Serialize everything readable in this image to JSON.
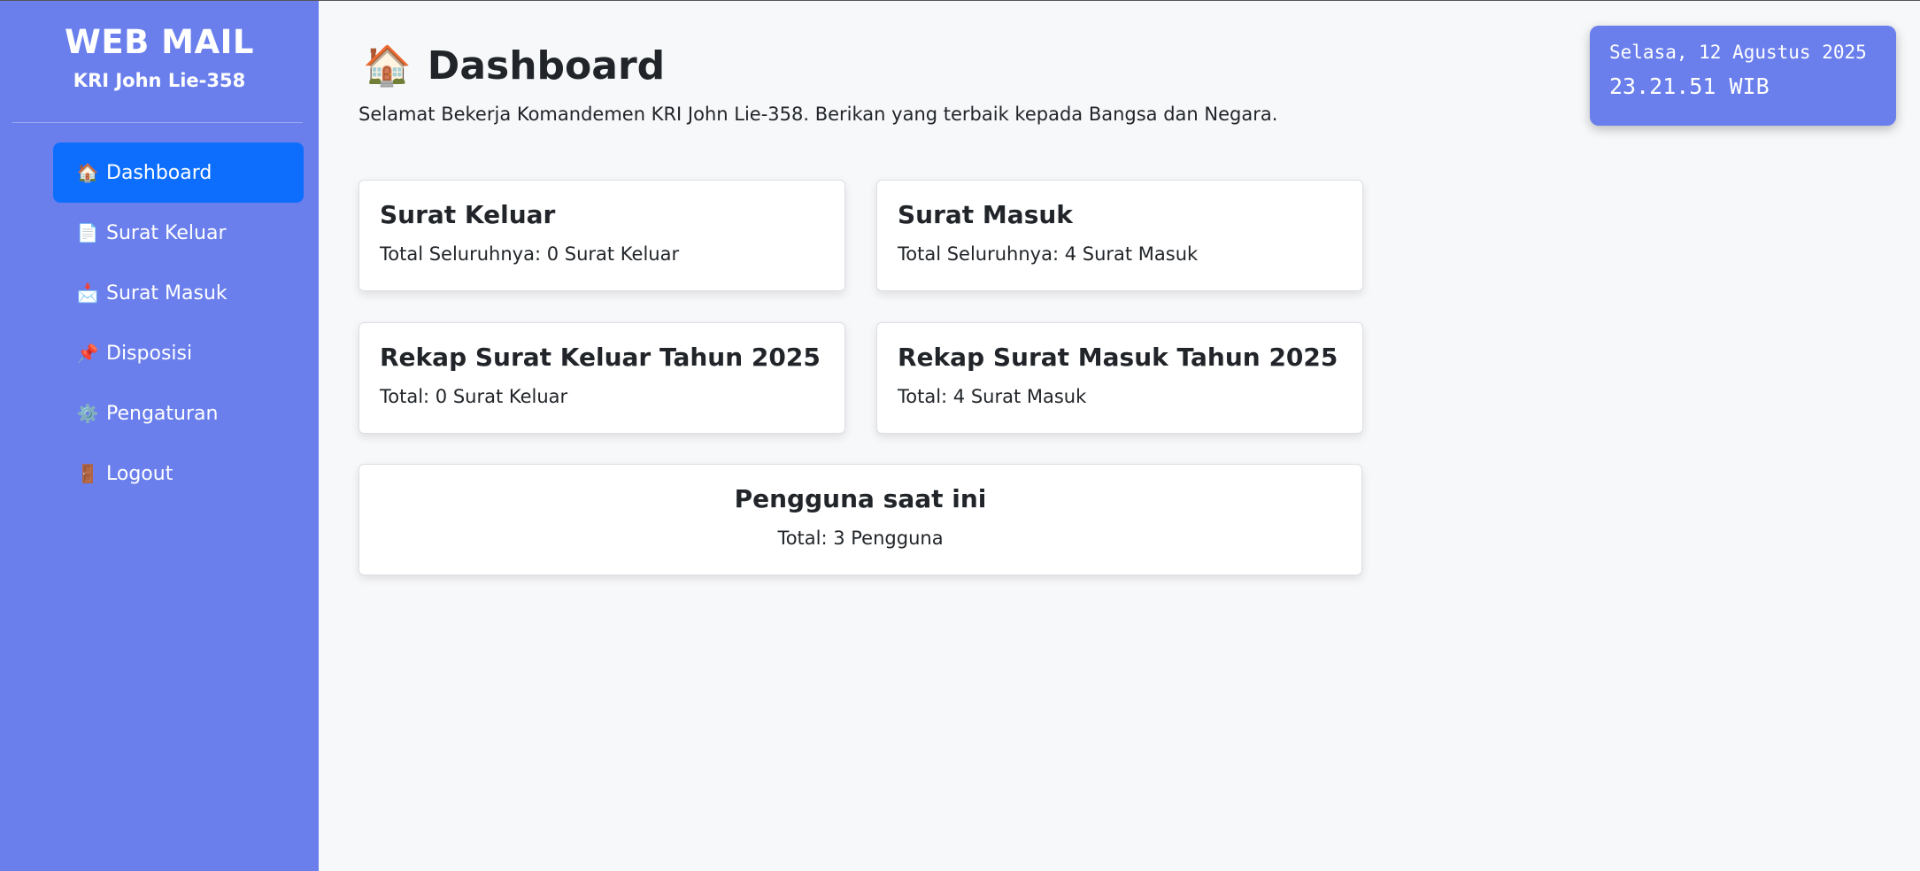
{
  "sidebar": {
    "title": "WEB MAIL",
    "subtitle": "KRI John Lie-358",
    "items": [
      {
        "label": "Dashboard",
        "icon": "🏠"
      },
      {
        "label": "Surat Keluar",
        "icon": "📄"
      },
      {
        "label": "Surat Masuk",
        "icon": "📩"
      },
      {
        "label": "Disposisi",
        "icon": "📌"
      },
      {
        "label": "Pengaturan",
        "icon": "⚙️"
      },
      {
        "label": "Logout",
        "icon": "🚪"
      }
    ]
  },
  "main": {
    "icon": "🏠",
    "title": "Dashboard",
    "welcome": "Selamat Bekerja Komandemen KRI John Lie-358. Berikan yang terbaik kepada Bangsa dan Negara.",
    "cards": [
      {
        "title": "Surat Keluar",
        "text": "Total Seluruhnya: 0 Surat Keluar"
      },
      {
        "title": "Surat Masuk",
        "text": "Total Seluruhnya: 4 Surat Masuk"
      },
      {
        "title": "Rekap Surat Keluar Tahun 2025",
        "text": "Total: 0 Surat Keluar"
      },
      {
        "title": "Rekap Surat Masuk Tahun 2025",
        "text": "Total: 4 Surat Masuk"
      },
      {
        "title": "Pengguna saat ini",
        "text": "Total: 3 Pengguna"
      }
    ]
  },
  "clock": {
    "date": "Selasa, 12 Agustus 2025",
    "time": "23.21.51 WIB"
  },
  "colors": {
    "sidebar": "#6a7fec",
    "active": "#0d6efd",
    "background": "#f7f8fa"
  }
}
